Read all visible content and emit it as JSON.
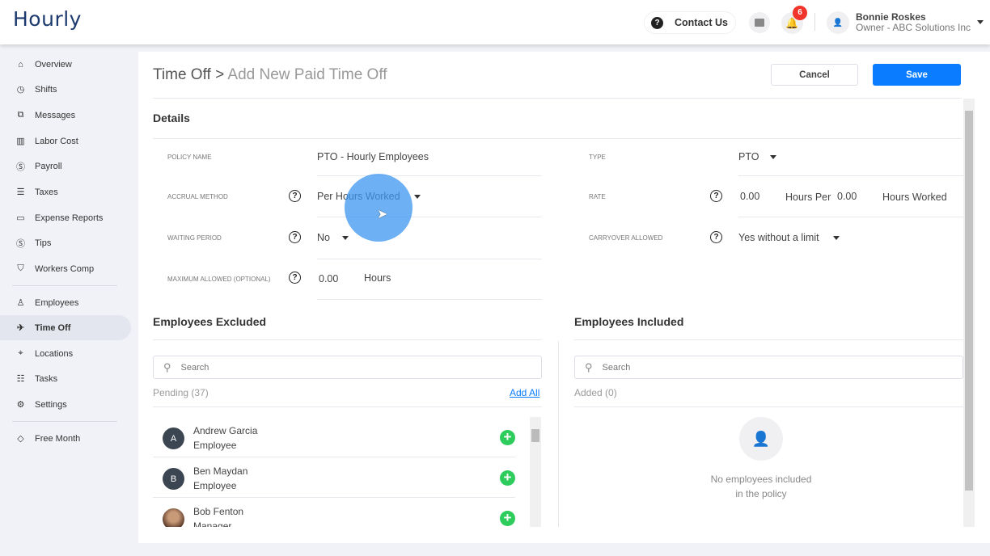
{
  "header": {
    "logo": "Hourly",
    "contact_us": "Contact Us",
    "notifications_count": "6",
    "user_name": "Bonnie Roskes",
    "user_role": "Owner - ABC Solutions Inc"
  },
  "sidebar": {
    "items": [
      {
        "label": "Overview",
        "icon": "home-icon"
      },
      {
        "label": "Shifts",
        "icon": "clock-icon"
      },
      {
        "label": "Messages",
        "icon": "messages-icon"
      },
      {
        "label": "Labor Cost",
        "icon": "bar-chart-icon"
      },
      {
        "label": "Payroll",
        "icon": "dollar-icon"
      },
      {
        "label": "Taxes",
        "icon": "document-icon"
      },
      {
        "label": "Expense Reports",
        "icon": "folder-icon"
      },
      {
        "label": "Tips",
        "icon": "dollar-icon"
      },
      {
        "label": "Workers Comp",
        "icon": "shield-icon"
      },
      {
        "label": "Employees",
        "icon": "person-icon"
      },
      {
        "label": "Time Off",
        "icon": "airplane-icon"
      },
      {
        "label": "Locations",
        "icon": "pin-icon"
      },
      {
        "label": "Tasks",
        "icon": "list-icon"
      },
      {
        "label": "Settings",
        "icon": "gear-icon"
      },
      {
        "label": "Free Month",
        "icon": "tag-icon"
      }
    ]
  },
  "page": {
    "breadcrumb_parent": "Time Off",
    "breadcrumb_sep": ">",
    "breadcrumb_current": "Add New Paid Time Off",
    "cancel": "Cancel",
    "save": "Save",
    "accent": "#0a7cff"
  },
  "details": {
    "title": "Details",
    "policy_name_label": "Policy Name",
    "policy_name": "PTO - Hourly Employees",
    "accrual_label": "Accrual Method",
    "accrual": "Per Hours Worked",
    "waiting_label": "Waiting Period",
    "waiting": "No",
    "max_label": "Maximum Allowed (Optional)",
    "max_value": "0.00",
    "max_unit": "Hours",
    "type_label": "Type",
    "type": "PTO",
    "rate_label": "Rate",
    "rate_value": "0.00",
    "rate_hours_per": "Hours Per",
    "rate_worked_value": "0.00",
    "rate_worked": "Hours Worked",
    "carryover_label": "Carryover Allowed",
    "carryover": "Yes without a limit"
  },
  "excluded": {
    "title": "Employees Excluded",
    "search_placeholder": "Search",
    "pending": "Pending (37)",
    "add_all": "Add All",
    "employees": [
      {
        "initial": "A",
        "name": "Andrew Garcia",
        "role": "Employee"
      },
      {
        "initial": "B",
        "name": "Ben Maydan",
        "role": "Employee"
      },
      {
        "initial": "",
        "name": "Bob Fenton",
        "role": "Manager"
      }
    ]
  },
  "included": {
    "title": "Employees Included",
    "search_placeholder": "Search",
    "added": "Added (0)",
    "empty_line1": "No employees included",
    "empty_line2": "in the policy"
  }
}
